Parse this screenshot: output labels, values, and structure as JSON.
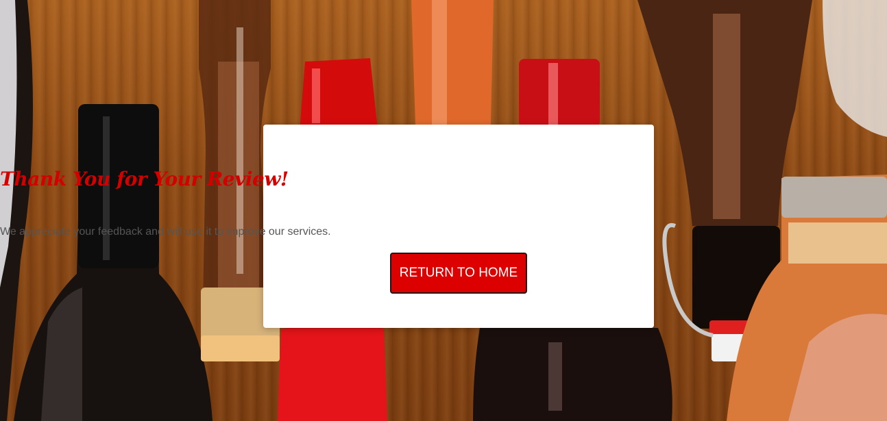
{
  "background": {
    "image": "wine-bottles-on-wood-photo"
  },
  "modal": {
    "title": "Thank You for Your Review!",
    "message": "We appreciate your feedback and will use it to improve our services.",
    "button_label": "RETURN TO HOME"
  },
  "colors": {
    "accent": "#d40000",
    "button_bg": "#dd0000",
    "button_border": "#1a1a1a",
    "card_bg": "#ffffff",
    "message_text": "#555555"
  }
}
